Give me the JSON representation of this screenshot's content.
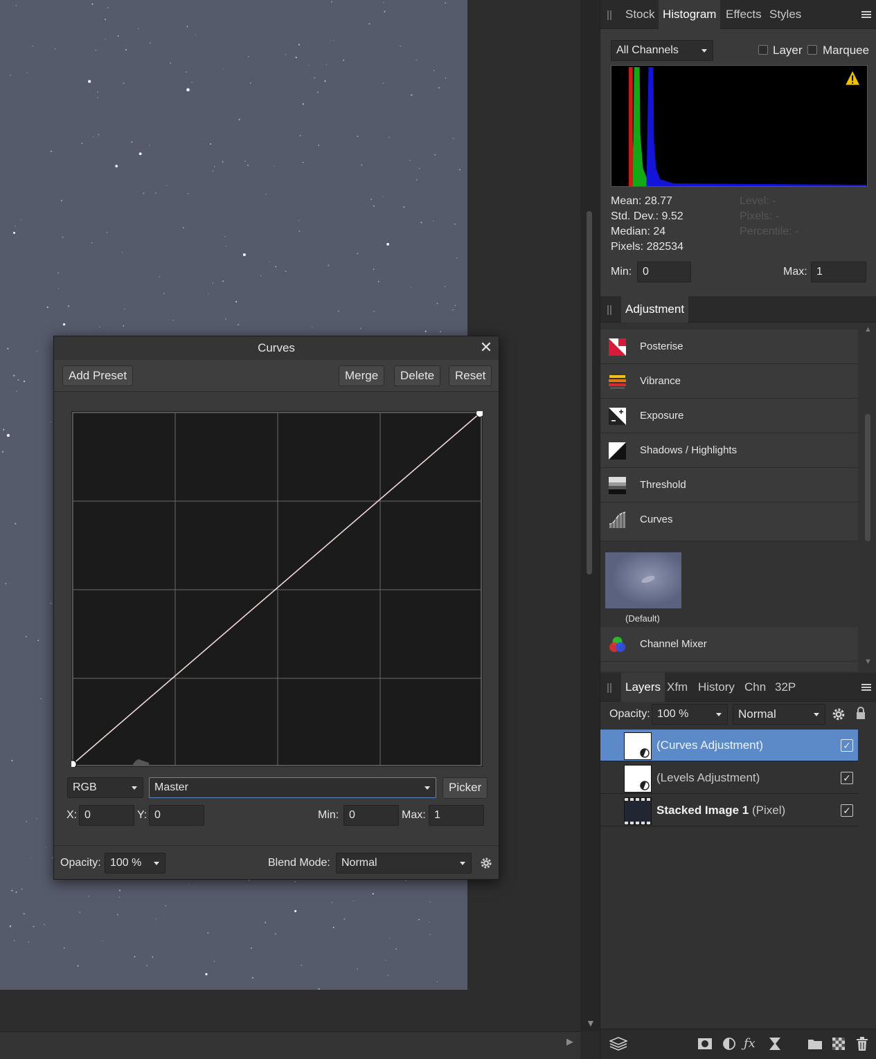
{
  "curves_dialog": {
    "title": "Curves",
    "buttons": {
      "add_preset": "Add Preset",
      "merge": "Merge",
      "delete": "Delete",
      "reset": "Reset",
      "picker": "Picker"
    },
    "color_space": "RGB",
    "channel": "Master",
    "x_label": "X:",
    "x_value": "0",
    "y_label": "Y:",
    "y_value": "0",
    "min_label": "Min:",
    "min_value": "0",
    "max_label": "Max:",
    "max_value": "1",
    "opacity_label": "Opacity:",
    "opacity_value": "100 %",
    "blend_label": "Blend Mode:",
    "blend_value": "Normal",
    "curve_points": [
      [
        0,
        0
      ],
      [
        1,
        1
      ]
    ]
  },
  "histogram_panel": {
    "tabs": [
      "Stock",
      "Histogram",
      "Effects",
      "Styles"
    ],
    "active_tab": "Histogram",
    "channels": "All Channels",
    "layer_label": "Layer",
    "marquee_label": "Marquee",
    "stats": {
      "mean": "Mean: 28.77",
      "std_dev": "Std. Dev.: 9.52",
      "median": "Median: 24",
      "pixels": "Pixels: 282534",
      "level": "Level: -",
      "pixels_hover": "Pixels: -",
      "percentile": "Percentile: -"
    },
    "min_label": "Min:",
    "min_value": "0",
    "max_label": "Max:",
    "max_value": "1",
    "warning_color": "#f2c200"
  },
  "adjustment_panel": {
    "tab": "Adjustment",
    "items": [
      {
        "label": "Posterise",
        "icon": "posterise-icon"
      },
      {
        "label": "Vibrance",
        "icon": "vibrance-icon"
      },
      {
        "label": "Exposure",
        "icon": "exposure-icon"
      },
      {
        "label": "Shadows / Highlights",
        "icon": "shadows-highlights-icon"
      },
      {
        "label": "Threshold",
        "icon": "threshold-icon"
      },
      {
        "label": "Curves",
        "icon": "curves-icon"
      },
      {
        "label": "Channel Mixer",
        "icon": "channel-mixer-icon"
      }
    ],
    "preset_label": "(Default)"
  },
  "layers_panel": {
    "tabs": [
      "Layers",
      "Xfm",
      "History",
      "Chn",
      "32P"
    ],
    "active_tab": "Layers",
    "opacity_label": "Opacity:",
    "opacity_value": "100 %",
    "blend_value": "Normal",
    "layers": [
      {
        "name": "(Curves Adjustment)",
        "selected": true,
        "visible": true
      },
      {
        "name": "(Levels Adjustment)",
        "selected": false,
        "visible": true
      },
      {
        "name": "Stacked Image 1",
        "type": "(Pixel)",
        "selected": false,
        "visible": true
      }
    ],
    "selection_color": "#5c8ac9"
  }
}
